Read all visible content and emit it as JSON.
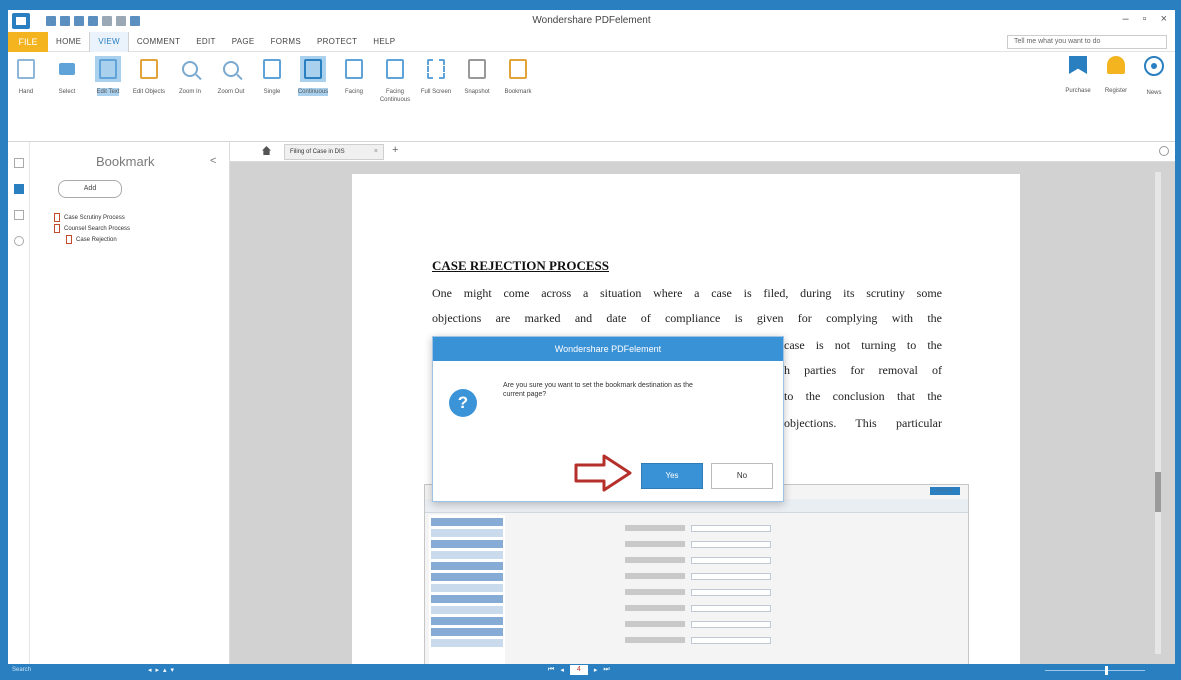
{
  "titlebar": {
    "app_title": "Wondershare PDFelement"
  },
  "menubar": {
    "file": "FILE",
    "items": [
      "HOME",
      "VIEW",
      "COMMENT",
      "EDIT",
      "PAGE",
      "FORMS",
      "PROTECT",
      "HELP"
    ],
    "tell_me": "Tell me what you want to do"
  },
  "ribbon": {
    "buttons": [
      "Hand",
      "Select",
      "Edit Text",
      "Edit Objects",
      "Zoom In",
      "Zoom Out",
      "Single",
      "Continuous",
      "Facing",
      "Facing Continuous",
      "Full Screen",
      "Snapshot",
      "Bookmark"
    ],
    "right": [
      "Purchase",
      "Register",
      "News"
    ]
  },
  "bookmarks": {
    "title": "Bookmark",
    "add": "Add",
    "items": [
      {
        "label": "Case Scrutiny Process",
        "level": 1
      },
      {
        "label": "Counsel Search Process",
        "level": 1
      },
      {
        "label": "Case Rejection",
        "level": 2
      }
    ]
  },
  "tab": {
    "doc_name": "Filing of Case in DIS"
  },
  "document": {
    "heading": "CASE REJECTION PROCESS",
    "line1": "One might come across a situation where a case is filed, during its scrutiny some",
    "line2": "objections are marked and date of compliance is given for complying with the",
    "line3": "case is not turning to the",
    "line4": "h parties for removal of",
    "line5": "to the conclusion that the",
    "line6": "objections. This particular"
  },
  "dialog": {
    "title": "Wondershare PDFelement",
    "message": "Are you sure you want to set the bookmark destination as the current page?",
    "yes": "Yes",
    "no": "No"
  },
  "statusbar": {
    "left": "Search",
    "page": "4"
  },
  "colors": {
    "accent": "#2a7fc1",
    "file_tab": "#f3b420",
    "arrow": "#b5302a"
  }
}
